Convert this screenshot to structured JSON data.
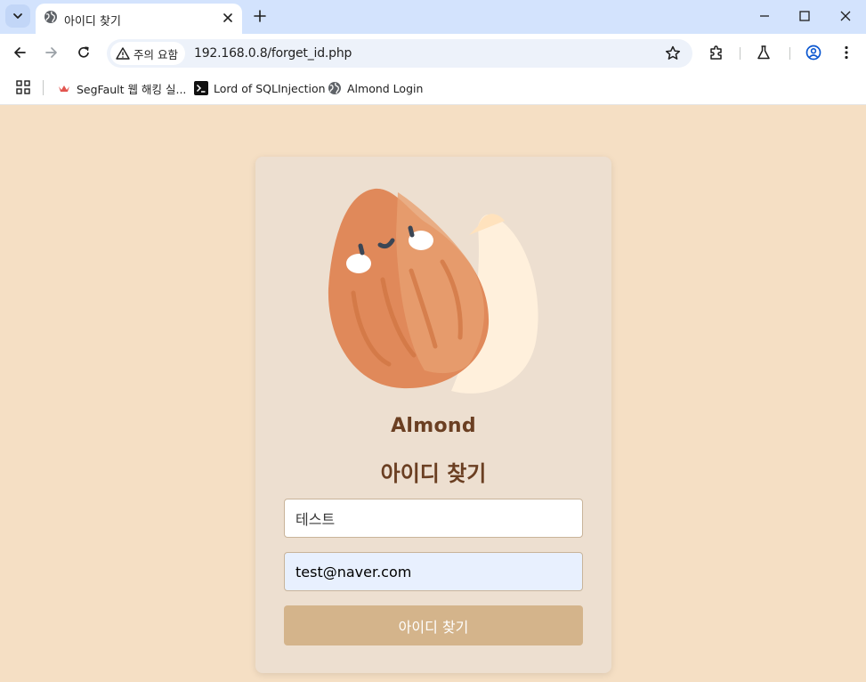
{
  "browser": {
    "tab_title": "아이디 찾기",
    "security_chip": "주의 요함",
    "url": "192.168.0.8/forget_id.php",
    "bookmarks": [
      {
        "label": "SegFault 웹 해킹 실..."
      },
      {
        "label": "Lord of SQLInjection"
      },
      {
        "label": "Almond Login"
      }
    ]
  },
  "page": {
    "brand": "Almond",
    "heading": "아이디 찾기",
    "name_value": "테스트",
    "email_value": "test@naver.com",
    "submit_label": "아이디 찾기"
  },
  "colors": {
    "page_bg": "#f5dfc4",
    "card_bg": "#eddfd0",
    "accent": "#d4b48b",
    "brand_text": "#6b3f22"
  },
  "icons": [
    "tab-list-icon",
    "globe-icon",
    "close-icon",
    "plus-icon",
    "minimize-icon",
    "maximize-icon",
    "back-arrow-icon",
    "forward-arrow-icon",
    "reload-icon",
    "warning-icon",
    "star-icon",
    "extensions-icon",
    "labs-flask-icon",
    "profile-icon",
    "more-menu-icon",
    "apps-grid-icon",
    "almond-logo"
  ]
}
